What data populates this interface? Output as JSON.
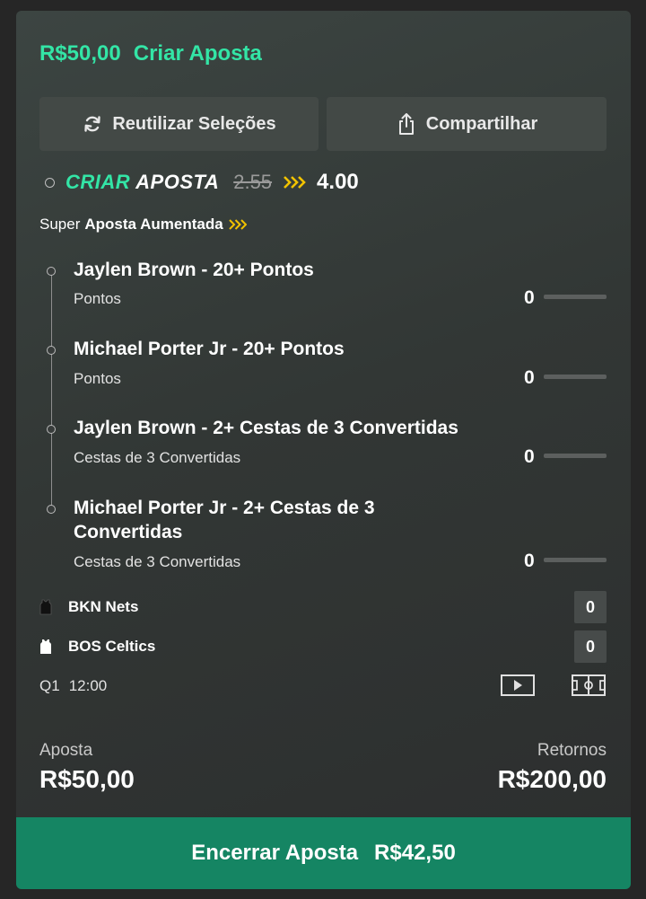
{
  "header": {
    "stake": "R$50,00",
    "title": "Criar Aposta"
  },
  "actions": {
    "reuse_label": "Reutilizar Seleções",
    "share_label": "Compartilhar"
  },
  "builder": {
    "logo_criar": "CRIAR",
    "logo_aposta": "APOSTA",
    "odds_old": "2.55",
    "odds_new": "4.00"
  },
  "boost": {
    "prefix": "Super",
    "label": "Aposta Aumentada"
  },
  "selections": [
    {
      "title": "Jaylen Brown - 20+ Pontos",
      "market": "Pontos",
      "value": "0"
    },
    {
      "title": "Michael Porter Jr - 20+ Pontos",
      "market": "Pontos",
      "value": "0"
    },
    {
      "title": "Jaylen Brown - 2+ Cestas de 3 Convertidas",
      "market": "Cestas de 3 Convertidas",
      "value": "0"
    },
    {
      "title": "Michael Porter Jr - 2+ Cestas de 3 Convertidas",
      "market": "Cestas de 3 Convertidas",
      "value": "0"
    }
  ],
  "teams": [
    {
      "name": "BKN Nets",
      "score": "0",
      "jersey_color": "#111111"
    },
    {
      "name": "BOS Celtics",
      "score": "0",
      "jersey_color": "#ffffff"
    }
  ],
  "game": {
    "period": "Q1",
    "clock": "12:00"
  },
  "summary": {
    "stake_label": "Aposta",
    "stake_value": "R$50,00",
    "returns_label": "Retornos",
    "returns_value": "R$200,00"
  },
  "cashout": {
    "label": "Encerrar Aposta",
    "amount": "R$42,50"
  },
  "colors": {
    "accent": "#33e5a6",
    "cashout_bg": "#158563",
    "boost_chevron": "#f2c300"
  }
}
